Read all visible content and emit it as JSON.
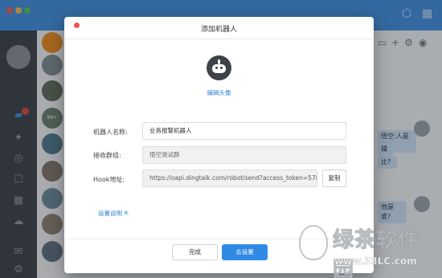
{
  "dialog": {
    "title": "添加机器人",
    "edit_avatar": "编辑头像",
    "fields": {
      "name_label": "机器人名称:",
      "name_value": "业务报警机器人",
      "group_label": "接收群组:",
      "group_value": "悟空测试群",
      "hook_label": "Hook地址:",
      "hook_value": "https://oapi.dingtalk.com/robot/send?access_token=5780"
    },
    "copy_label": "复制",
    "settings_link": "设置说明",
    "done_label": "完成",
    "setup_label": "去设置"
  },
  "background_app": {
    "conv_badge": "99+",
    "chat_bubble_1": "悟空:人是什么",
    "chat_bubble_2": "辑",
    "chat_bubble_3": "比?",
    "chat_bubble_4": "他是谁?"
  },
  "watermark": {
    "brand": "绿茶软件园",
    "url": "www.33LC.com"
  },
  "colors": {
    "titlebar": "#3f8fe0",
    "primary_button": "#2f8ae6",
    "link": "#2a7fd4",
    "close_dot": "#ef5350"
  },
  "icons": {
    "robot_avatar": "robot-icon",
    "external_link": "external-link-icon"
  }
}
